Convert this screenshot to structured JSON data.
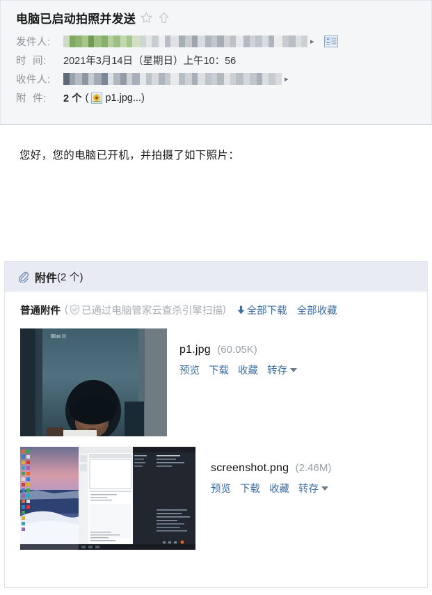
{
  "mail": {
    "subject": "电脑已启动拍照并发送",
    "icons": {
      "star": "star-icon",
      "forward": "up-arrow-icon"
    },
    "fields": {
      "sender_label": "发件人:",
      "sender_value_redacted": true,
      "time_label": "时  间:",
      "time_value": "2021年3月14日（星期日）上午10：56",
      "recipient_label": "收件人:",
      "recipient_value_redacted": true,
      "attachment_label": "附  件:",
      "attachment_count": "2 个",
      "attachment_paren_open": "(",
      "attachment_inline_name": "p1.jpg...",
      "attachment_paren_close": ")"
    }
  },
  "body": {
    "text": "您好，您的电脑已开机，并拍摄了如下照片："
  },
  "attachments_panel": {
    "header_title": "附件",
    "header_count": "(2 个)",
    "section_title": "普通附件",
    "scan_note_open": "(",
    "scan_note_text": "已通过电脑管家云查杀引擎扫描",
    "scan_note_close": ")",
    "bulk": {
      "download_all": "全部下载",
      "favorite_all": "全部收藏"
    },
    "actions": {
      "preview": "预览",
      "download": "下载",
      "favorite": "收藏",
      "save_to": "转存"
    },
    "files": [
      {
        "name": "p1.jpg",
        "size": "(60.05K)",
        "thumbnail": "webcam-photo-thumbnail"
      },
      {
        "name": "screenshot.png",
        "size": "(2.46M)",
        "thumbnail": "desktop-screenshot-thumbnail"
      }
    ]
  },
  "colors": {
    "link": "#3b6ea5",
    "header_bg": "#f5f6f7",
    "panel_head_bg": "#e8ebf4",
    "muted": "#9aa0a6"
  }
}
